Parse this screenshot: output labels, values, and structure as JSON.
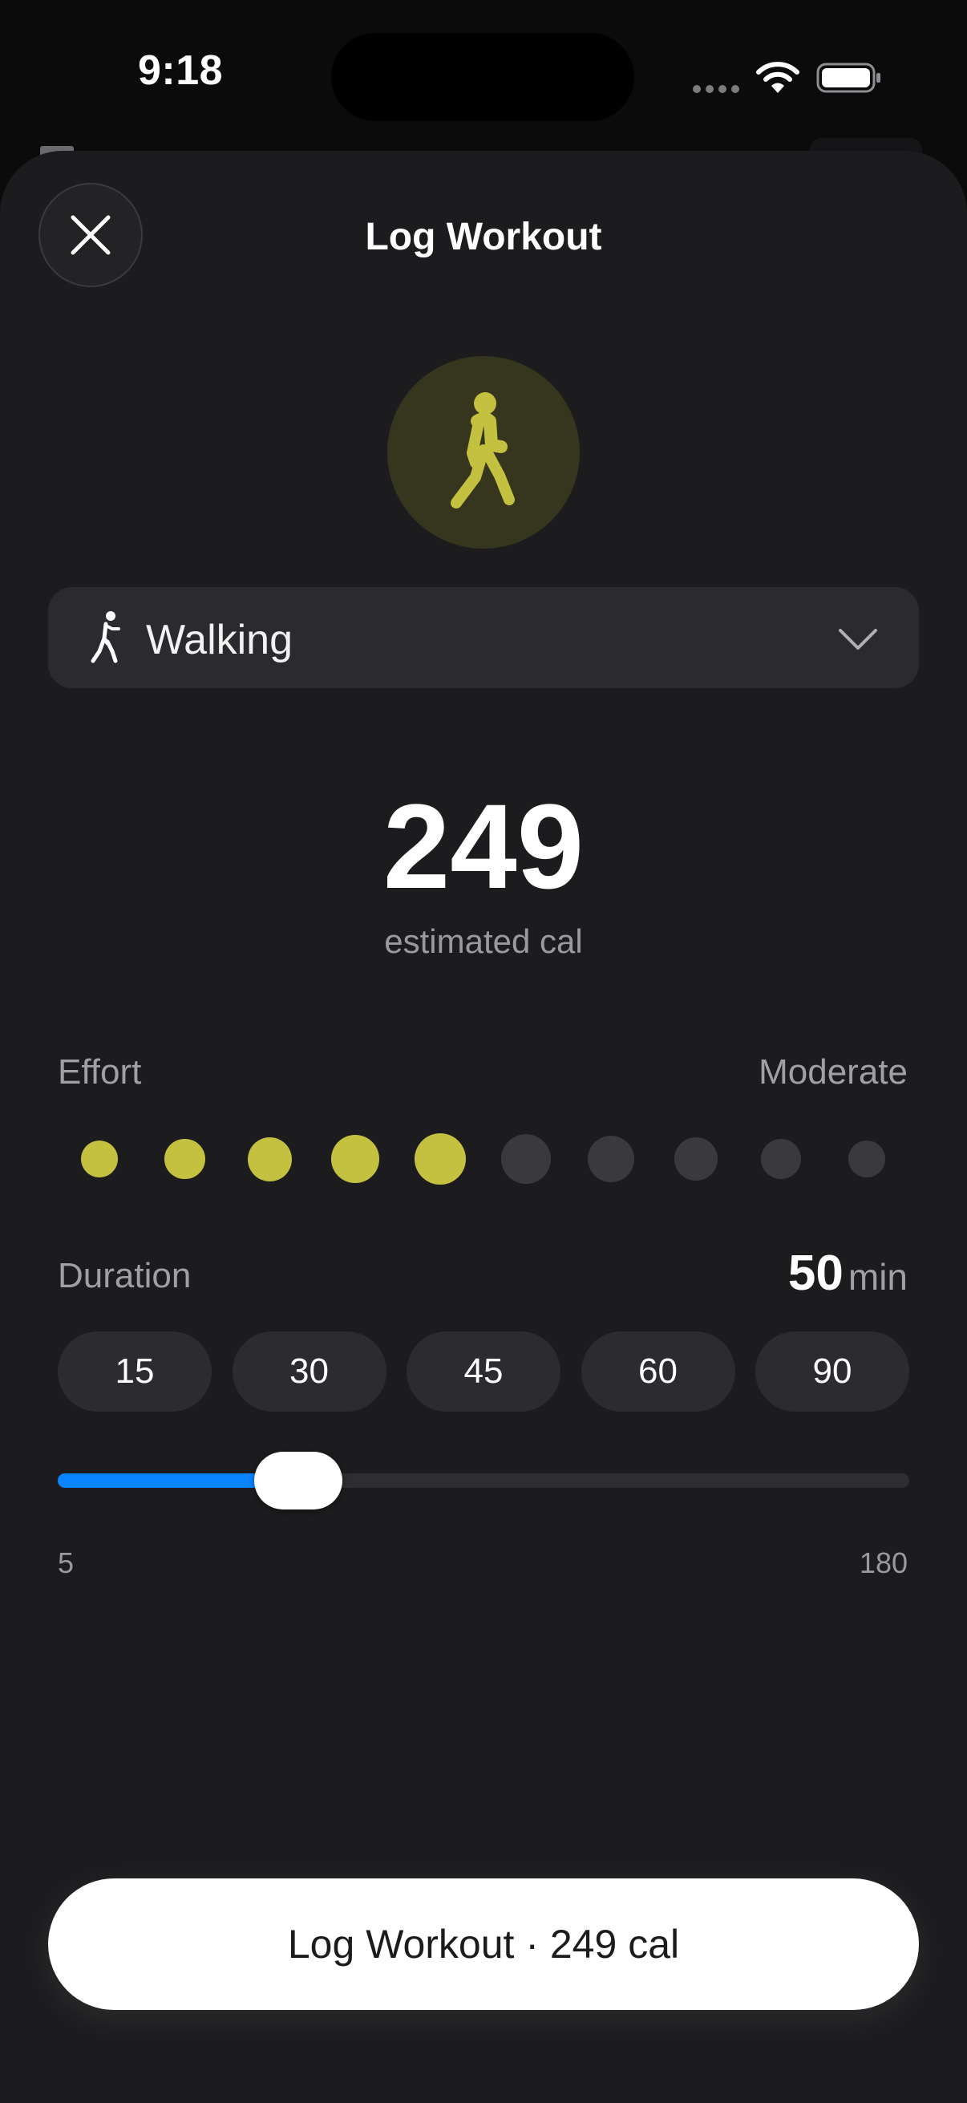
{
  "status_bar": {
    "time": "9:18"
  },
  "header": {
    "title": "Log Workout",
    "close_icon": "xmark-icon"
  },
  "activity": {
    "badge_icon": "figure-walk-icon",
    "badge_color": "#c4c040",
    "selected": "Walking",
    "picker_icon": "figure-walk-icon",
    "chevron_icon": "chevron-down-icon"
  },
  "calories": {
    "value": "249",
    "label": "estimated cal"
  },
  "effort": {
    "label": "Effort",
    "level_label": "Moderate",
    "level": 5,
    "max": 10,
    "active_color": "#c4c040",
    "inactive_color": "#3a3a3d"
  },
  "duration": {
    "label": "Duration",
    "value": "50",
    "unit": "min",
    "presets": [
      "15",
      "30",
      "45",
      "60",
      "90"
    ],
    "slider": {
      "min": 5,
      "max": 180,
      "value": 50,
      "min_label": "5",
      "max_label": "180",
      "accent": "#0a84ff"
    }
  },
  "action": {
    "label": "Log Workout · 249 cal"
  }
}
